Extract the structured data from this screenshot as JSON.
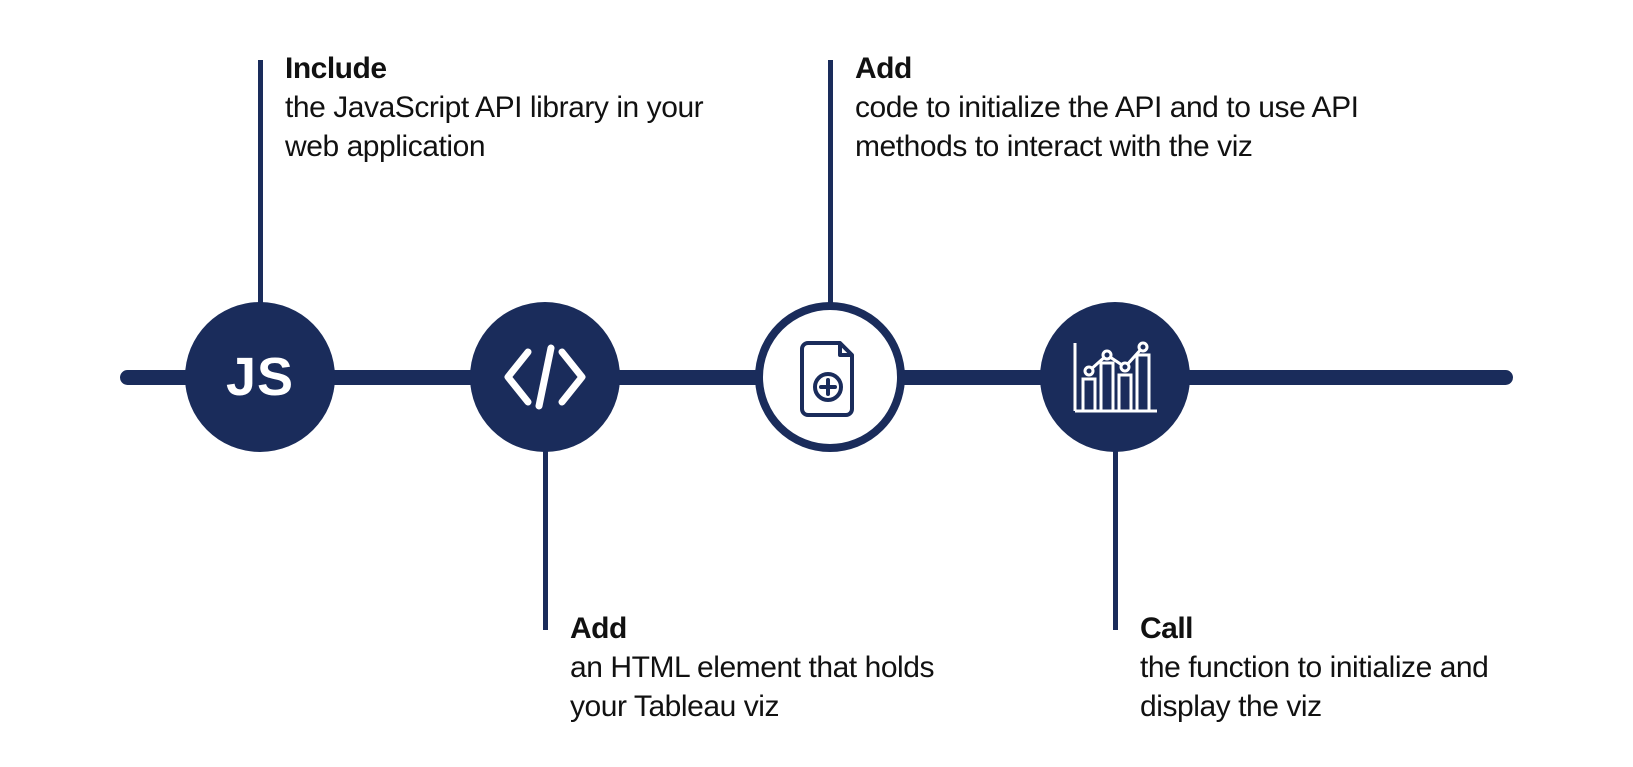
{
  "colors": {
    "navy": "#1a2c5b",
    "white": "#ffffff"
  },
  "steps": [
    {
      "icon": "js-icon",
      "icon_label": "JS",
      "title": "Include",
      "description": "the JavaScript API library in your web application",
      "label_position": "top"
    },
    {
      "icon": "code-icon",
      "title": "Add",
      "description": "an HTML element that holds your Tableau viz",
      "label_position": "bottom"
    },
    {
      "icon": "file-plus-icon",
      "title": "Add",
      "description": "code to initialize the API and to use API methods to interact with the viz",
      "label_position": "top"
    },
    {
      "icon": "chart-icon",
      "title": "Call",
      "description": "the function to initialize and display the viz",
      "label_position": "bottom"
    }
  ]
}
